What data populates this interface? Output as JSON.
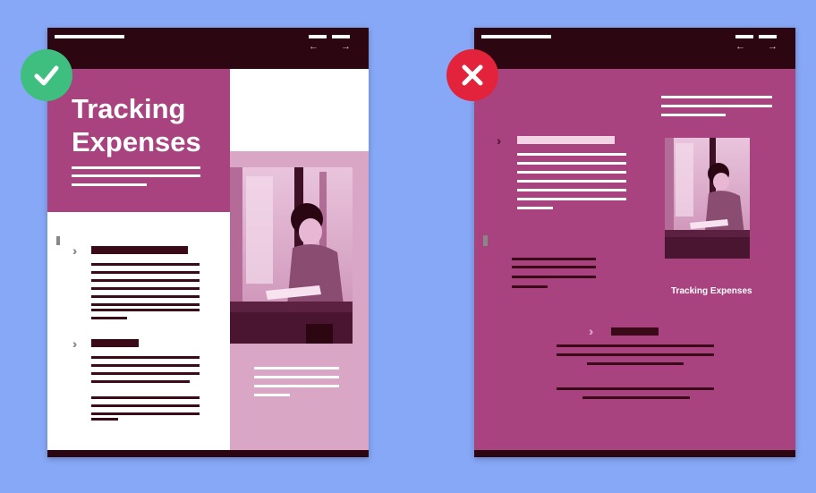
{
  "good_example": {
    "title_line1": "Tracking",
    "title_line2": "Expenses",
    "nav_prev": "←",
    "nav_next": "→",
    "badge_icon": "checkmark-icon"
  },
  "bad_example": {
    "caption": "Tracking Expenses",
    "nav_prev": "←",
    "nav_next": "→",
    "badge_icon": "x-mark-icon"
  },
  "colors": {
    "background": "#87a8f6",
    "magenta": "#a8437f",
    "dark_burgundy": "#2c0712",
    "light_pink": "#d9a6c6",
    "check_green": "#3fbf7f",
    "cross_red": "#e2233b"
  }
}
